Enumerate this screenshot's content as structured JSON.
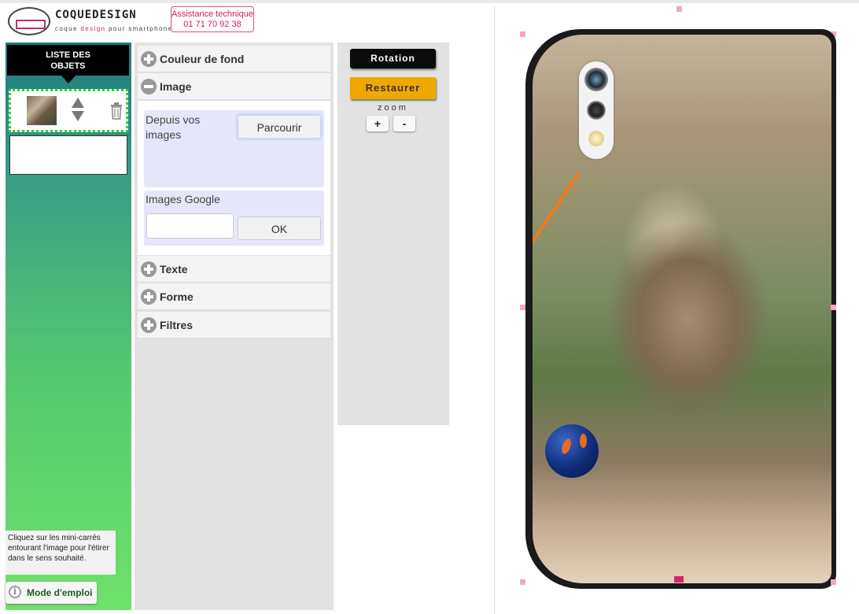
{
  "header": {
    "logo_name": "COQUEDESIGN",
    "tagline_pre": "coque ",
    "tagline_hl": "design",
    "tagline_post": " pour smartphone",
    "assist_title": "Assistance technique",
    "assist_phone": "01 71 70 92 38"
  },
  "objects": {
    "header_line1": "LISTE DES",
    "header_line2": "OBJETS",
    "hint": "Cliquez sur les mini-carrés entourant l'image pour l'étirer dans le sens souhaité.",
    "mode_label": "Mode d'emploi",
    "info_glyph": "i"
  },
  "accordion": {
    "sections": [
      {
        "label": "Couleur de fond",
        "state": "collapsed"
      },
      {
        "label": "Image",
        "state": "expanded"
      },
      {
        "label": "Texte",
        "state": "collapsed"
      },
      {
        "label": "Forme",
        "state": "collapsed"
      },
      {
        "label": "Filtres",
        "state": "collapsed"
      }
    ],
    "image": {
      "local_label": "Depuis vos images",
      "browse_label": "Parcourir",
      "google_label": "Images Google",
      "google_value": "",
      "ok_label": "OK"
    }
  },
  "tools": {
    "rotation_label": "Rotation",
    "restore_label": "Restaurer",
    "zoom_label": "zoom",
    "zoom_in": "+",
    "zoom_out": "-"
  },
  "colors": {
    "accent_pink": "#d11e5a",
    "restore_orange": "#f0a800",
    "panel_green_top": "#1d7a7a",
    "panel_green_bottom": "#6ee26a",
    "selected_border": "#26d23a"
  },
  "icons": [
    "logo-mark",
    "up-arrow-icon",
    "down-arrow-icon",
    "trash-icon",
    "plus-icon",
    "minus-icon",
    "info-icon"
  ]
}
